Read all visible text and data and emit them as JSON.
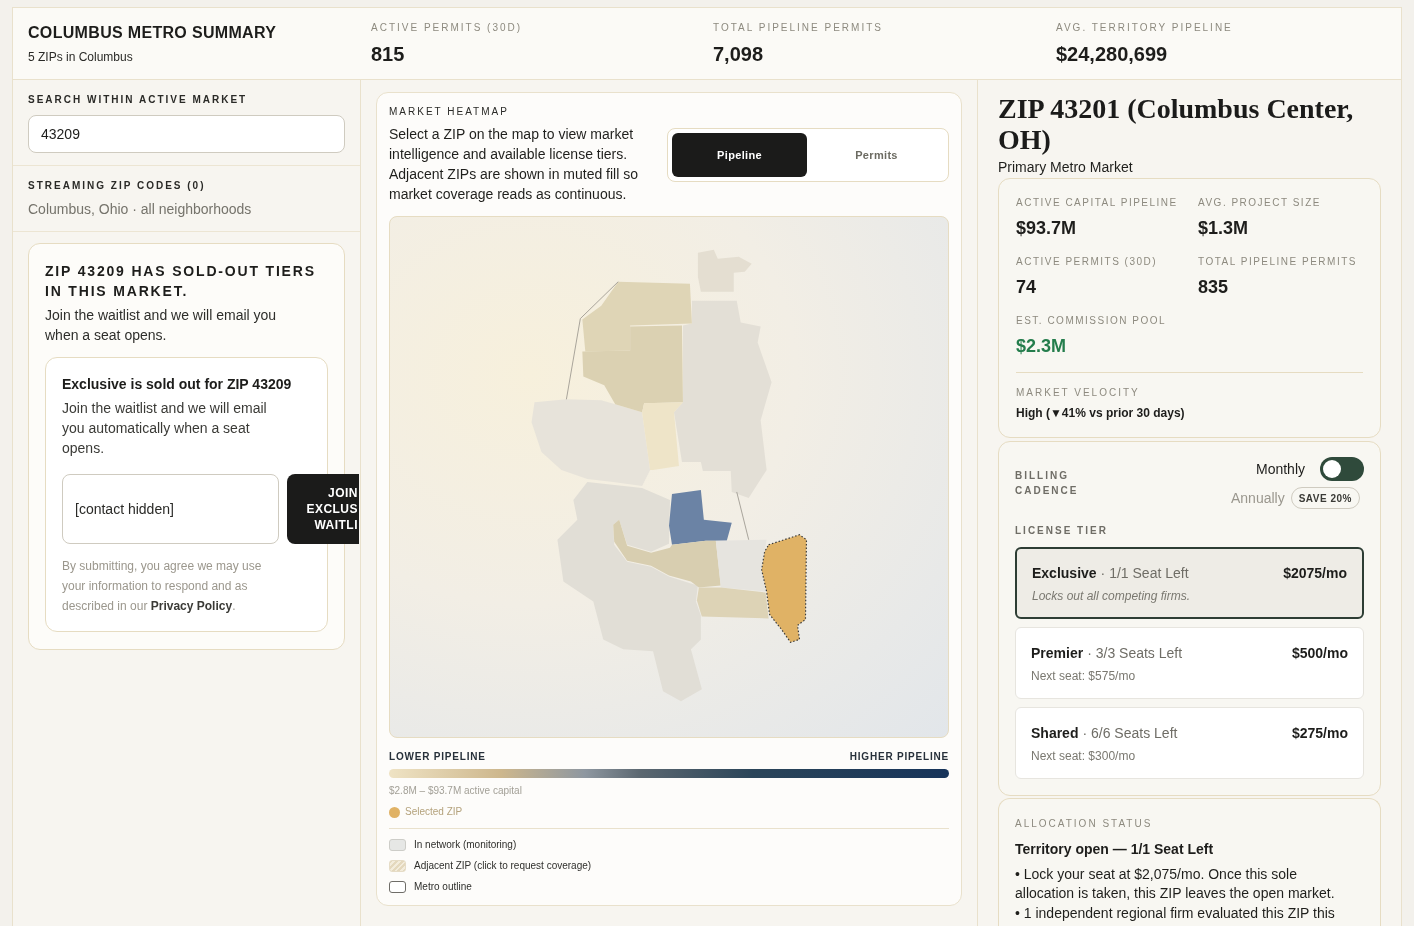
{
  "summary": {
    "title": "COLUMBUS METRO SUMMARY",
    "subtitle": "5 ZIPs in Columbus",
    "stats": [
      {
        "label": "ACTIVE PERMITS (30D)",
        "value": "815"
      },
      {
        "label": "TOTAL PIPELINE PERMITS",
        "value": "7,098"
      },
      {
        "label": "AVG. TERRITORY PIPELINE",
        "value": "$24,280,699"
      }
    ]
  },
  "sidebar": {
    "search": {
      "label": "SEARCH WITHIN ACTIVE MARKET",
      "value": "43209"
    },
    "streaming": {
      "label": "STREAMING ZIP CODES (0)",
      "text": "Columbus, Ohio · all neighborhoods"
    },
    "waitlist": {
      "title": "ZIP 43209 HAS SOLD-OUT TIERS IN THIS MARKET.",
      "text": "Join the waitlist and we will email you when a seat opens.",
      "form": {
        "title": "Exclusive is sold out for ZIP 43209",
        "text": "Join the waitlist and we will email you automatically when a seat opens.",
        "contact_value": "[contact hidden]",
        "button": "JOIN EXCLUS WAITLI",
        "consent": "By submitting, you agree we may use your information to respond and as described in our",
        "consent_link": "Privacy Policy",
        "consent_end": "."
      }
    }
  },
  "heatmap": {
    "title": "MARKET HEATMAP",
    "description": "Select a ZIP on the map to view market intelligence and available license tiers. Adjacent ZIPs are shown in muted fill so market coverage reads as continuous.",
    "modes": [
      {
        "label": "Pipeline",
        "selected": true
      },
      {
        "label": "Permits",
        "selected": false
      }
    ],
    "scale": {
      "low": "LOWER PIPELINE",
      "high": "HIGHER PIPELINE",
      "range": "$2.8M – $93.7M active capital"
    },
    "selected_key": {
      "label": "Selected ZIP",
      "color": "#e0b265"
    },
    "legend": [
      {
        "kind": "solid",
        "label": "In network (monitoring)"
      },
      {
        "kind": "hatched",
        "label": "Adjacent ZIP (click to request coverage)"
      },
      {
        "kind": "outline",
        "label": "Metro outline"
      }
    ]
  },
  "zip_detail": {
    "title": "ZIP 43201 (Columbus Center, OH)",
    "subtitle": "Primary Metro Market",
    "metrics": [
      {
        "kind": "plain",
        "label": "ACTIVE CAPITAL PIPELINE",
        "value": "$93.7M"
      },
      {
        "kind": "plain",
        "label": "AVG. PROJECT SIZE",
        "value": "$1.3M"
      },
      {
        "kind": "plain",
        "label": "ACTIVE PERMITS (30D)",
        "value": "74"
      },
      {
        "kind": "plain",
        "label": "TOTAL PIPELINE PERMITS",
        "value": "835"
      },
      {
        "kind": "positive",
        "label": "EST. COMMISSION POOL",
        "value": "$2.3M"
      }
    ],
    "velocity": {
      "label": "MARKET VELOCITY",
      "value": "High (▼41% vs prior 30 days)"
    }
  },
  "billing": {
    "label": "BILLING CADENCE",
    "options": [
      {
        "label": "Monthly",
        "selected": true
      },
      {
        "label": "Annually",
        "selected": false,
        "badge": "SAVE 20%"
      }
    ]
  },
  "license": {
    "label": "LICENSE TIER",
    "tiers": [
      {
        "kind": "exclusive",
        "name": "Exclusive",
        "seats": "· 1/1 Seat Left",
        "price": "$2075/mo",
        "note": "Locks out all competing firms.",
        "selected": true
      },
      {
        "kind": "standard",
        "name": "Premier",
        "seats": "· 3/3 Seats Left",
        "price": "$500/mo",
        "note": "Next seat: $575/mo",
        "selected": false
      },
      {
        "kind": "standard",
        "name": "Shared",
        "seats": "· 6/6 Seats Left",
        "price": "$275/mo",
        "note": "Next seat: $300/mo",
        "selected": false
      }
    ]
  },
  "allocation": {
    "label": "ALLOCATION STATUS",
    "title": "Territory open — 1/1 Seat Left",
    "bullets": [
      "• Lock your seat at $2,075/mo. Once this sole allocation is taken, this ZIP leaves the open market.",
      "• 1 independent regional firm evaluated this ZIP this"
    ]
  }
}
